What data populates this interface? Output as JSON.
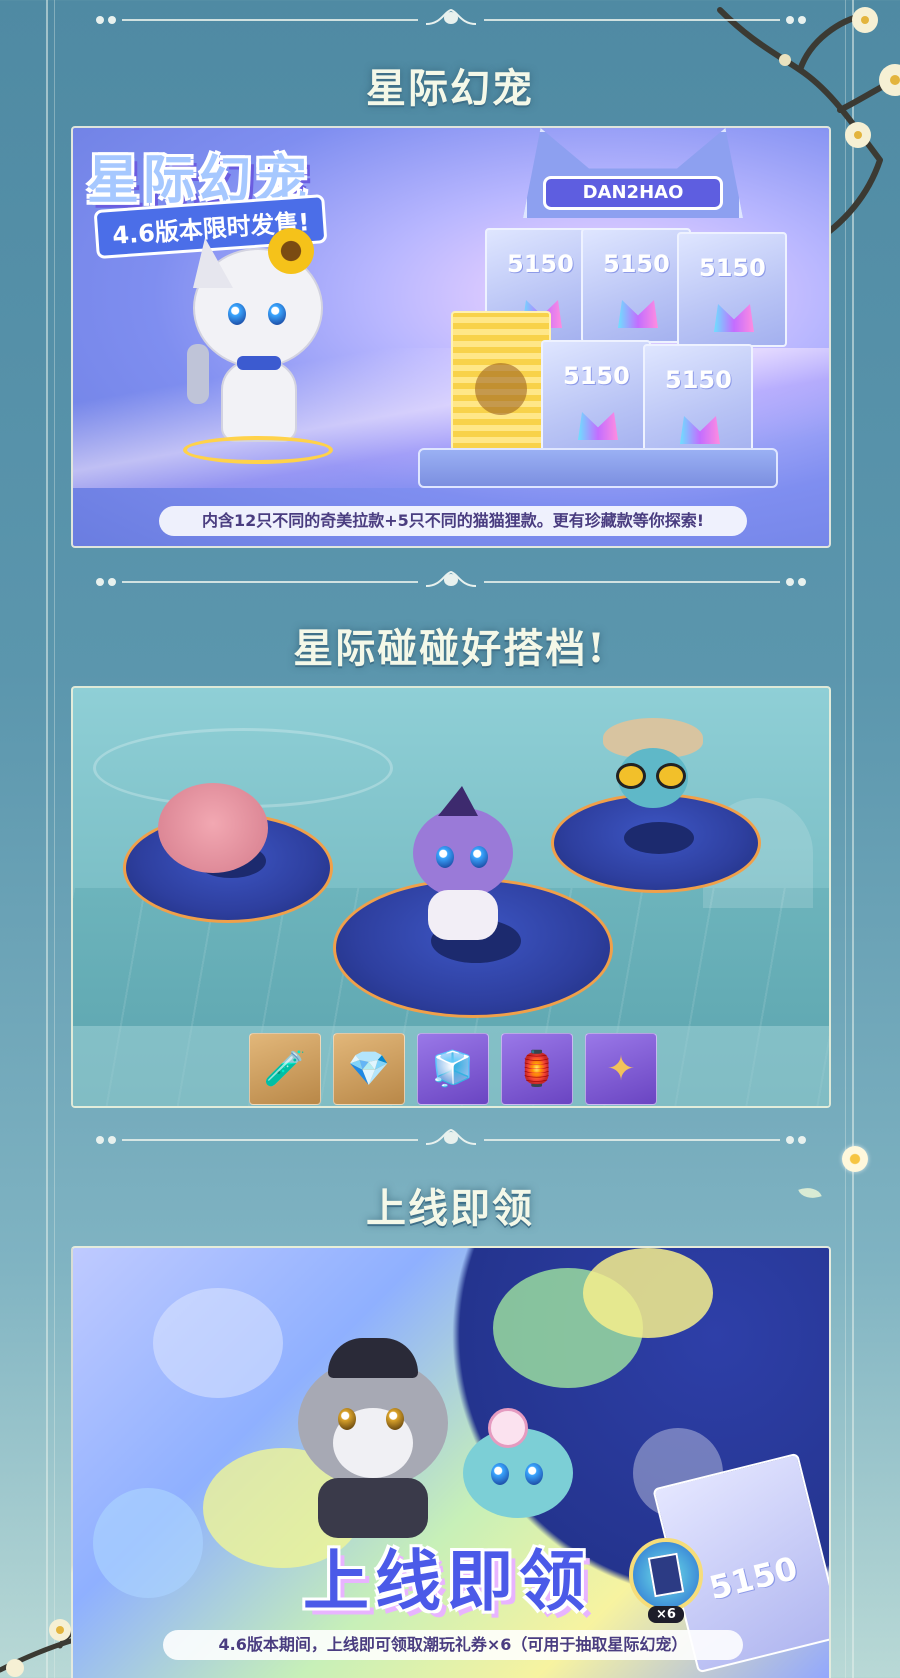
{
  "sections": [
    {
      "title": "星际幻宠",
      "banner_title": "星际幻宠",
      "banner_subtitle": "4.6版本限时发售!",
      "sign_text": "DAN2HAO",
      "box_logo": "5150",
      "caption": "内含12只不同的奇美拉款+5只不同的猫猫狸款。更有珍藏款等你探索!"
    },
    {
      "title": "星际碰碰好搭档!",
      "items": [
        {
          "icon": "potion-orb-icon",
          "glyph": "🧪",
          "rarity": "gold"
        },
        {
          "icon": "crystal-icon",
          "glyph": "💎",
          "rarity": "gold"
        },
        {
          "icon": "cube-icon",
          "glyph": "🧊",
          "rarity": "purple"
        },
        {
          "icon": "lantern-icon",
          "glyph": "🏮",
          "rarity": "purple"
        },
        {
          "icon": "gold-crystal-icon",
          "glyph": "✦",
          "rarity": "purple"
        }
      ]
    },
    {
      "title": "上线即领",
      "banner_text": "上线即领",
      "ticket_count": "×6",
      "caption": "4.6版本期间，上线即可领取潮玩礼券×6（可用于抽取星际幻宠）"
    }
  ],
  "colors": {
    "background": "#5b96ad",
    "title_text": "#f4f8e8",
    "caption_text": "#4a3d80",
    "accent_blue": "#4b5ae8"
  }
}
